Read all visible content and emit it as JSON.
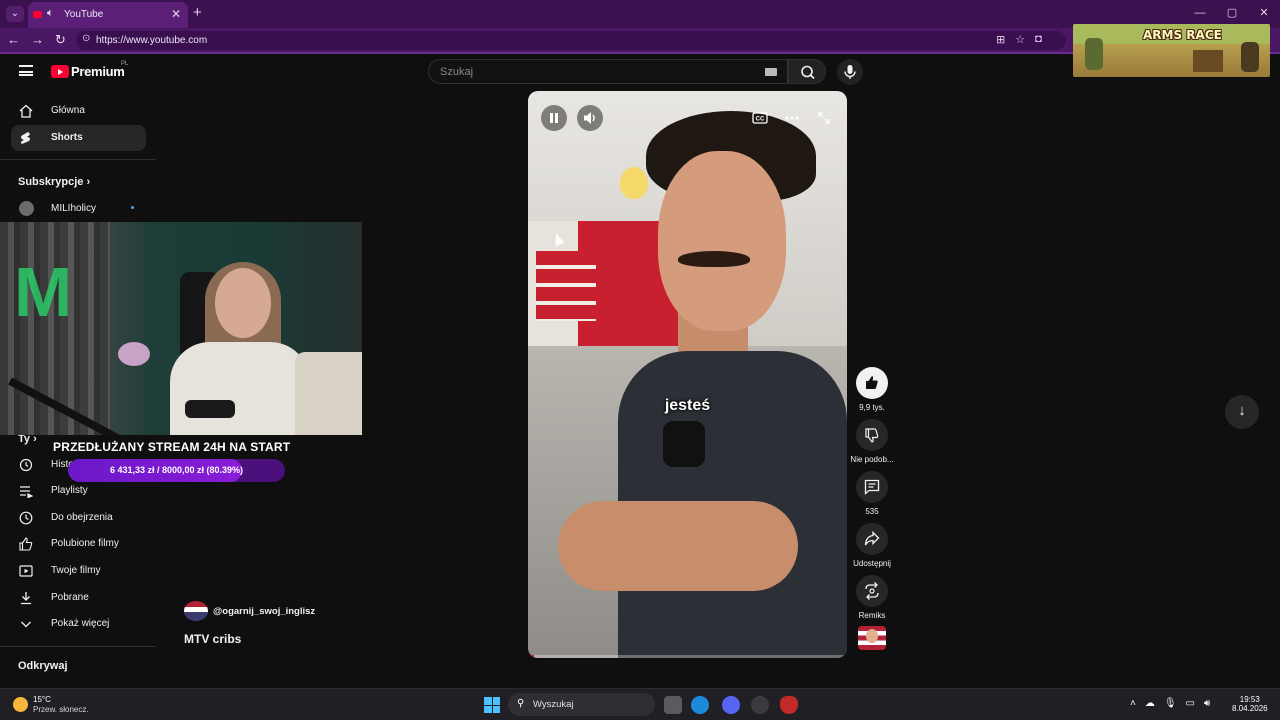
{
  "browser": {
    "tab_title": "YouTube",
    "url": "https://www.youtube.com",
    "window_controls": [
      "—",
      "▢",
      "✕"
    ]
  },
  "header": {
    "brand": "Premium",
    "brand_region": "PL",
    "search_placeholder": "Szukaj"
  },
  "sidebar": {
    "main": [
      {
        "label": "Główna",
        "icon": "home-icon"
      },
      {
        "label": "Shorts",
        "icon": "shorts-icon",
        "active": true
      }
    ],
    "subscriptions_heading": "Subskrypcje",
    "subscriptions": [
      {
        "label": "MILIholicy"
      }
    ],
    "you_heading": "Ty",
    "you_items": [
      {
        "label": "Historia",
        "visible_text": "Histo",
        "icon": "history-icon"
      },
      {
        "label": "Playlisty",
        "icon": "playlist-icon"
      },
      {
        "label": "Do obejrzenia",
        "icon": "clock-icon"
      },
      {
        "label": "Polubione filmy",
        "icon": "thumbs-up-icon"
      },
      {
        "label": "Twoje filmy",
        "icon": "video-icon"
      },
      {
        "label": "Pobrane",
        "icon": "download-icon"
      },
      {
        "label": "Pokaż więcej",
        "icon": "chevron-down-icon"
      }
    ],
    "explore_heading": "Odkrywaj"
  },
  "stream_overlay": {
    "title": "PRZEDŁUŻANY STREAM 24H NA START",
    "goal_text": "6 431,33 zł / 8000,00 zł (80.39%)",
    "goal_fraction": 0.8039
  },
  "short": {
    "caption": "jesteś",
    "progress_fraction": 0.02,
    "channel_handle": "@ogarnij_swoj_inglisz",
    "title": "MTV cribs",
    "actions": {
      "likes": "9,9 tys.",
      "dislike": "Nie podob...",
      "comments": "535",
      "share": "Udostępnij",
      "remix": "Remiks"
    }
  },
  "game_overlay": {
    "title": "ARMS RACE"
  },
  "taskbar": {
    "temperature": "15°C",
    "weather": "Przew. słonecz.",
    "search_label": "Wyszukaj",
    "time": "19:53",
    "date": "8.04.2026"
  }
}
